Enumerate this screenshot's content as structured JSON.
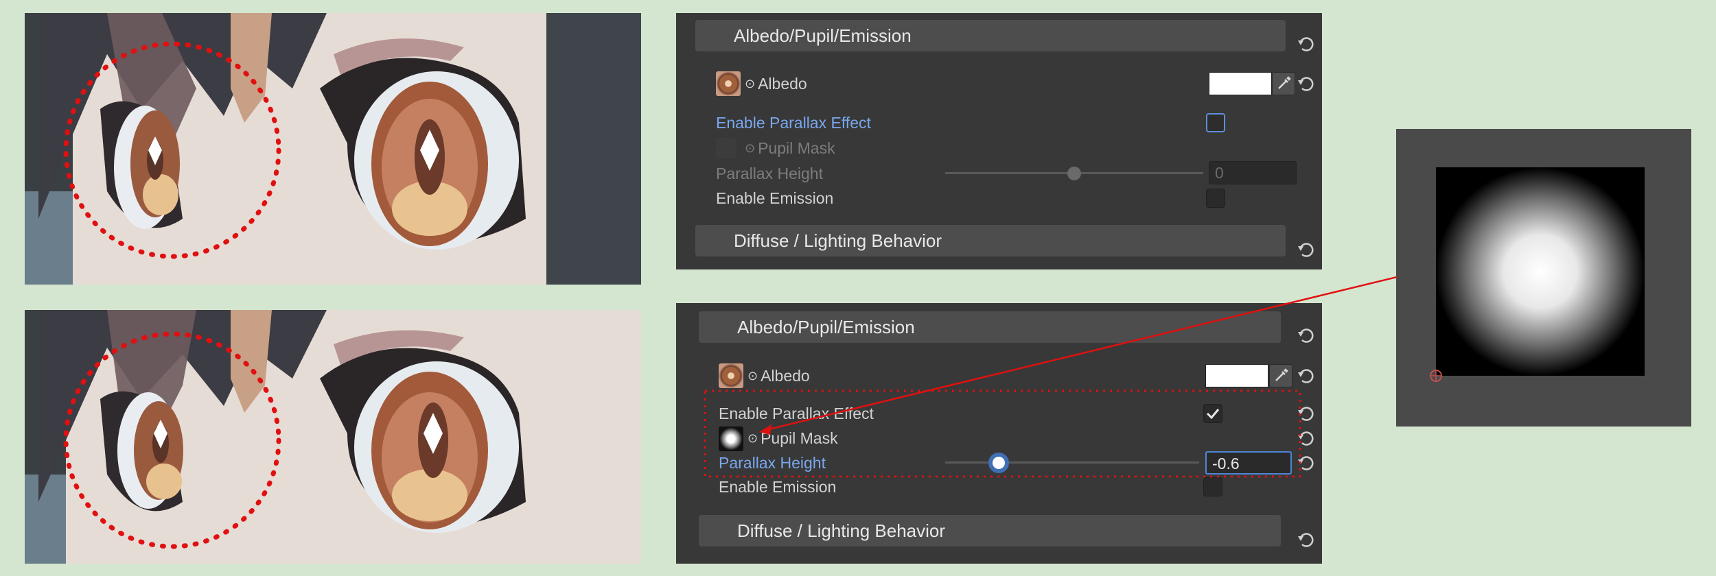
{
  "panels": [
    {
      "id": "before",
      "header": "Albedo/Pupil/Emission",
      "albedo_label": "Albedo",
      "albedo_prefix": "⊙",
      "albedo_color": "#ffffff",
      "parallax_label": "Enable Parallax Effect",
      "parallax_checked": false,
      "mask_label": "Pupil Mask",
      "mask_prefix": "⊙",
      "height_label": "Parallax Height",
      "height_value": "0",
      "height_slider_fraction": 0.5,
      "emission_label": "Enable Emission",
      "emission_checked": false,
      "footer_header": "Diffuse / Lighting Behavior"
    },
    {
      "id": "after",
      "header": "Albedo/Pupil/Emission",
      "albedo_label": "Albedo",
      "albedo_prefix": "⊙",
      "albedo_color": "#ffffff",
      "parallax_label": "Enable Parallax Effect",
      "parallax_checked": true,
      "mask_label": "Pupil Mask",
      "mask_prefix": "⊙",
      "height_label": "Parallax Height",
      "height_value": "-0.6",
      "height_slider_fraction": 0.21,
      "emission_label": "Enable Emission",
      "emission_checked": false,
      "footer_header": "Diffuse / Lighting Behavior"
    }
  ],
  "icons": {
    "revert": "revert-icon",
    "eyedropper": "eyedropper-icon",
    "checkmark": "checkmark-icon",
    "texture": "texture-thumbnail-icon"
  },
  "colors": {
    "background": "#d5e6d0",
    "inspector_bg": "#383838",
    "highlight_red": "#e01010",
    "accent_blue": "#7aa7ee"
  }
}
